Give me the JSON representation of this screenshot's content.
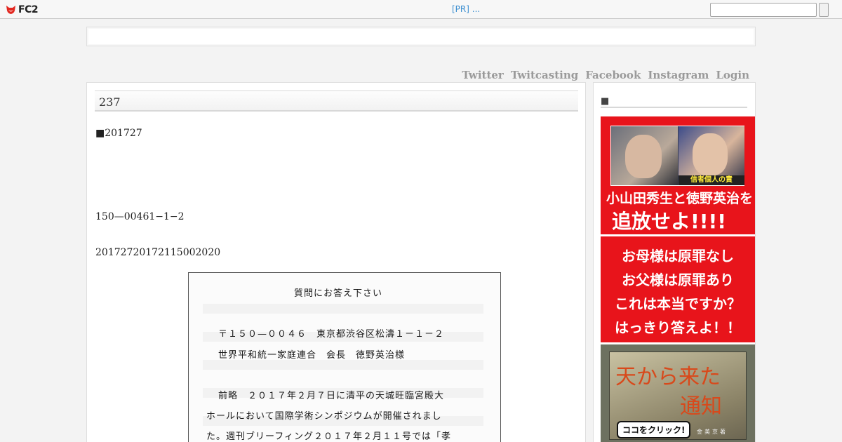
{
  "topbar": {
    "logo_text": "FC2",
    "pr_text": "[PR] ...",
    "search_value": ""
  },
  "nav": {
    "items": [
      "Twitter",
      "Twitcasting",
      "Facebook",
      "Instagram",
      "Login"
    ]
  },
  "post": {
    "title": "237",
    "line1": "■201727",
    "line2": "150—00461−1−2",
    "line3": "20172720172115002020"
  },
  "letter": {
    "lines": [
      "質問にお答え下さい",
      "〒１５０—００４６　東京都渋谷区松濤１－１－２",
      "世界平和統一家庭連合　会長　徳野英治様",
      "前略　２０１７年２月７日に清平の天城旺臨宮殿大",
      "ホールにおいて国際学術シンポジウムが開催されまし",
      "た。週刊ブリーフィング２０１７年２月１１号では「孝"
    ]
  },
  "sidebar": {
    "title": "■",
    "ad1": {
      "caption": "信者個人の責",
      "line1": "小山田秀生と徳野英治を",
      "line2": "追放せよ!!!!"
    },
    "ad2": {
      "lines": [
        "お母様は原罪なし",
        "お父様は原罪あり",
        "これは本当ですか？",
        "はっきり答えよ！！"
      ]
    },
    "ad3": {
      "title1": "天から来た",
      "title2": "通知",
      "button": "ココをクリック!",
      "author": "金美京著"
    }
  },
  "colors": {
    "ad_red": "#e8141b",
    "nav_gray": "#9a9a9a",
    "pr_blue": "#3a8ed0"
  }
}
